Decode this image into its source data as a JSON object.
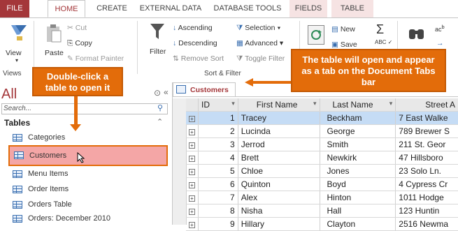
{
  "ribbon_tabs": [
    "FILE",
    "HOME",
    "CREATE",
    "EXTERNAL DATA",
    "DATABASE TOOLS",
    "FIELDS",
    "TABLE"
  ],
  "ribbon": {
    "view": "View",
    "views_group": "Views",
    "paste": "Paste",
    "cut": "Cut",
    "copy": "Copy",
    "format_painter": "Format Painter",
    "filter": "Filter",
    "ascending": "Ascending",
    "descending": "Descending",
    "remove_sort": "Remove Sort",
    "selection": "Selection",
    "advanced": "Advanced",
    "toggle_filter": "Toggle Filter",
    "sort_filter_group": "Sort & Filter",
    "new": "New",
    "save": "Save"
  },
  "nav": {
    "title": "All",
    "search_placeholder": "Search...",
    "section": "Tables",
    "items": [
      "Categories",
      "Customers",
      "Menu Items",
      "Order Items",
      "Orders Table",
      "Orders: December 2010"
    ]
  },
  "document_tab": "Customers",
  "table": {
    "columns": [
      "ID",
      "First Name",
      "Last Name",
      "Street A"
    ],
    "rows": [
      [
        "1",
        "Tracey",
        "Beckham",
        "7 East Walke"
      ],
      [
        "2",
        "Lucinda",
        "George",
        "789 Brewer S"
      ],
      [
        "3",
        "Jerrod",
        "Smith",
        "211 St. Geor"
      ],
      [
        "4",
        "Brett",
        "Newkirk",
        "47 Hillsboro"
      ],
      [
        "5",
        "Chloe",
        "Jones",
        "23 Solo Ln."
      ],
      [
        "6",
        "Quinton",
        "Boyd",
        "4 Cypress Cr"
      ],
      [
        "7",
        "Alex",
        "Hinton",
        "1011 Hodge"
      ],
      [
        "8",
        "Nisha",
        "Hall",
        "123 Huntin"
      ],
      [
        "9",
        "Hillary",
        "Clayton",
        "2516 Newma"
      ]
    ]
  },
  "callouts": {
    "left": "Double-click a table to open it",
    "right": "The table will open and appear as a tab on the Document Tabs bar"
  },
  "colors": {
    "accent": "#a4373a",
    "callout": "#e36c0a",
    "selected_row": "#c5dcf5",
    "highlight": "#f4a6a6"
  }
}
